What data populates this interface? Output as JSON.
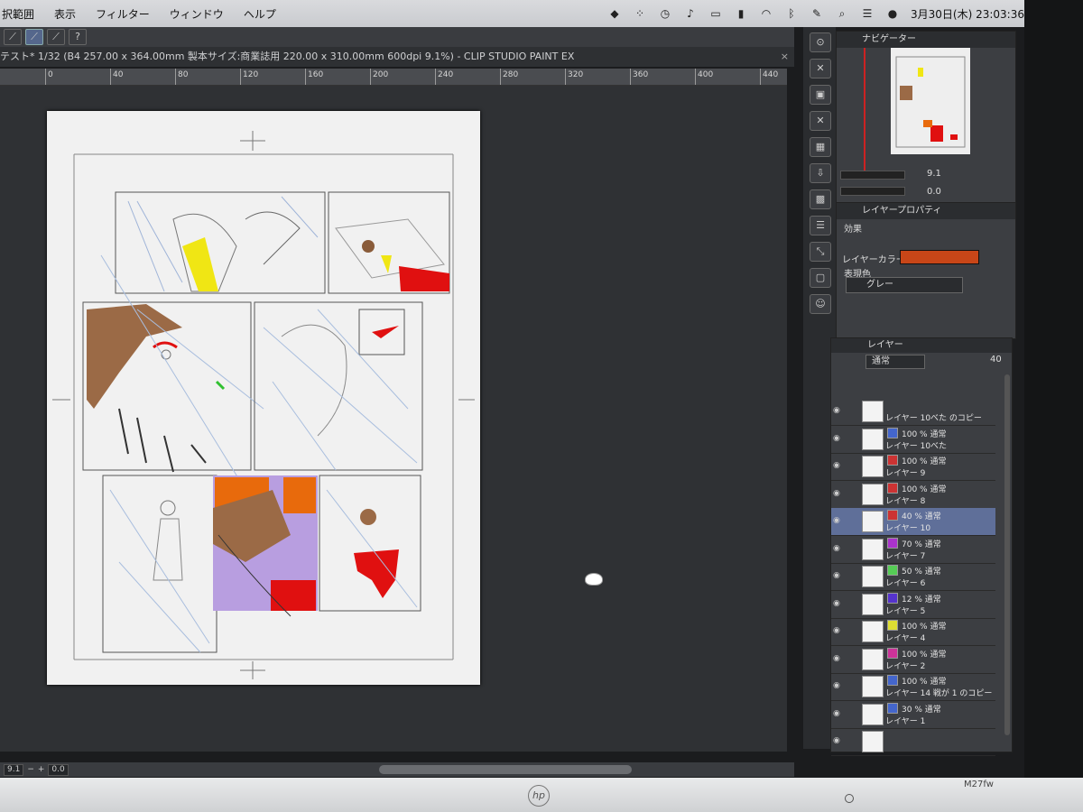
{
  "menubar": {
    "items": [
      "択範囲",
      "表示",
      "フィルター",
      "ウィンドウ",
      "ヘルプ"
    ],
    "clock": "3月30日(木) 23:03:36",
    "tray_icons": [
      "dropbox-icon",
      "grid-icon",
      "time-machine-icon",
      "music-icon",
      "display-icon",
      "battery-icon",
      "wifi-icon",
      "bluetooth-icon",
      "pen-icon",
      "search-icon",
      "control-icon",
      "siri-icon"
    ]
  },
  "tools": [
    "pen-tool-icon",
    "brush-tool-icon",
    "pencil-tool-icon",
    "help-icon"
  ],
  "title": "テスト* 1/32 (B4 257.00 x 364.00mm 製本サイズ:商業誌用 220.00 x 310.00mm 600dpi 9.1%)  - CLIP STUDIO PAINT EX",
  "ruler": {
    "labels": [
      "0",
      "40",
      "80",
      "120",
      "160",
      "200",
      "240",
      "280",
      "320",
      "360",
      "400",
      "440"
    ]
  },
  "statusbar": {
    "zoom": "9.1",
    "rotation": "0.0"
  },
  "right_icons": [
    "zoom-icon",
    "close-icon",
    "save-icon",
    "close-icon",
    "layer-icon",
    "export-icon",
    "grid-icon",
    "stack-icon",
    "transform-icon",
    "frame-icon",
    "people-icon"
  ],
  "navigator": {
    "tab": "ナビゲーター",
    "zoom": "9.1",
    "rotation": "0.0"
  },
  "layer_properties": {
    "tab": "レイヤープロパティ",
    "effect_label": "効果",
    "color_label": "レイヤーカラー",
    "layer_color": "#c84618",
    "expression_label": "表現色",
    "expression_value": "グレー"
  },
  "layers": {
    "tab": "レイヤー",
    "blend_mode": "通常",
    "opacity": "40",
    "rows": [
      {
        "mode": "",
        "name": "レイヤー 10べた のコピー",
        "selected": false
      },
      {
        "mode": "100 % 通常",
        "name": "レイヤー 10べた",
        "selected": false
      },
      {
        "mode": "100 % 通常",
        "name": "レイヤー 9",
        "selected": false
      },
      {
        "mode": "100 % 通常",
        "name": "レイヤー 8",
        "selected": false
      },
      {
        "mode": "40 % 通常",
        "name": "レイヤー 10",
        "selected": true
      },
      {
        "mode": "70 % 通常",
        "name": "レイヤー 7",
        "selected": false
      },
      {
        "mode": "50 % 通常",
        "name": "レイヤー 6",
        "selected": false
      },
      {
        "mode": "12 % 通常",
        "name": "レイヤー 5",
        "selected": false
      },
      {
        "mode": "100 % 通常",
        "name": "レイヤー 4",
        "selected": false
      },
      {
        "mode": "100 % 通常",
        "name": "レイヤー 2",
        "selected": false
      },
      {
        "mode": "100 % 通常",
        "name": "レイヤー 14 戦が 1 のコピー",
        "selected": false
      },
      {
        "mode": "30 % 通常",
        "name": "レイヤー 1",
        "selected": false
      },
      {
        "mode": "",
        "name": "",
        "selected": false
      }
    ]
  },
  "monitor": {
    "brand": "hp",
    "model": "M27fw"
  }
}
